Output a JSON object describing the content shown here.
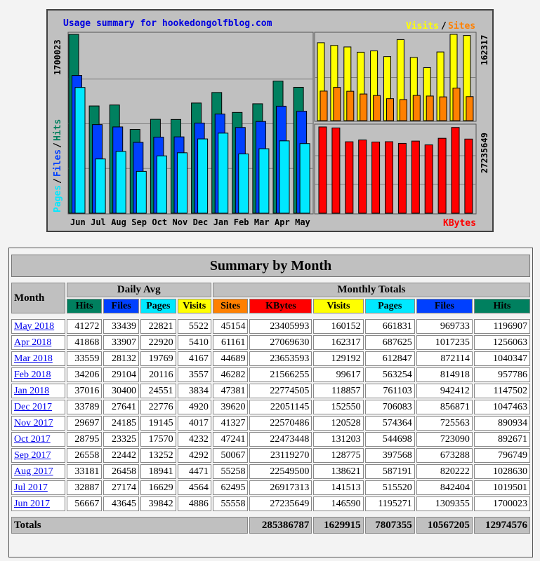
{
  "title": "Usage summary for hookedongolfblog.com",
  "labels": {
    "left_axis": [
      "Pages",
      "Files",
      "Hits"
    ],
    "right_top_legend": [
      "Visits",
      "Sites"
    ],
    "right_bottom_legend": "KBytes",
    "left_max": "1700023",
    "right_top_max": "162317",
    "right_bottom_max": "27235649"
  },
  "colors": {
    "hits": "#00805f",
    "files": "#0040ff",
    "pages": "#00e8ff",
    "visits": "#ffff00",
    "sites": "#ff8000",
    "kbytes": "#ff0000"
  },
  "chart_data": [
    {
      "type": "bar",
      "title": "Usage summary for hookedongolfblog.com",
      "categories": [
        "Jun",
        "Jul",
        "Aug",
        "Sep",
        "Oct",
        "Nov",
        "Dec",
        "Jan",
        "Feb",
        "Mar",
        "Apr",
        "May"
      ],
      "ylim": [
        0,
        1700023
      ],
      "series": [
        {
          "name": "Hits",
          "values": [
            1700023,
            1019501,
            1028630,
            796749,
            892671,
            890934,
            1047463,
            1147502,
            957786,
            1040347,
            1256063,
            1196907
          ]
        },
        {
          "name": "Files",
          "values": [
            1309355,
            842404,
            820222,
            673288,
            723090,
            725563,
            856871,
            942412,
            814918,
            872114,
            1017235,
            969733
          ]
        },
        {
          "name": "Pages",
          "values": [
            1195271,
            515520,
            587191,
            397568,
            544698,
            574364,
            706083,
            761103,
            563254,
            612847,
            687625,
            661831
          ]
        }
      ]
    },
    {
      "type": "bar",
      "categories": [
        "Jun",
        "Jul",
        "Aug",
        "Sep",
        "Oct",
        "Nov",
        "Dec",
        "Jan",
        "Feb",
        "Mar",
        "Apr",
        "May"
      ],
      "ylim": [
        0,
        162317
      ],
      "series": [
        {
          "name": "Visits",
          "values": [
            146590,
            141513,
            138621,
            128775,
            131203,
            120528,
            152550,
            118857,
            99617,
            129192,
            162317,
            160152
          ]
        },
        {
          "name": "Sites",
          "values": [
            55558,
            62495,
            55258,
            50067,
            47241,
            41327,
            39620,
            47381,
            46282,
            44689,
            61161,
            45154
          ]
        }
      ]
    },
    {
      "type": "bar",
      "categories": [
        "Jun",
        "Jul",
        "Aug",
        "Sep",
        "Oct",
        "Nov",
        "Dec",
        "Jan",
        "Feb",
        "Mar",
        "Apr",
        "May"
      ],
      "ylim": [
        0,
        27235649
      ],
      "series": [
        {
          "name": "KBytes",
          "values": [
            27235649,
            26917313,
            22549500,
            23119270,
            22473448,
            22570486,
            22051145,
            22774505,
            21566255,
            23653593,
            27069630,
            23405993
          ]
        }
      ]
    }
  ],
  "table": {
    "title": "Summary by Month",
    "month_header": "Month",
    "daily_avg_header": "Daily Avg",
    "monthly_totals_header": "Monthly Totals",
    "daily_cols": [
      "Hits",
      "Files",
      "Pages",
      "Visits"
    ],
    "monthly_cols": [
      "Sites",
      "KBytes",
      "Visits",
      "Pages",
      "Files",
      "Hits"
    ],
    "rows": [
      {
        "month": "May 2018",
        "d": [
          "41272",
          "33439",
          "22821",
          "5522"
        ],
        "m": [
          "45154",
          "23405993",
          "160152",
          "661831",
          "969733",
          "1196907"
        ]
      },
      {
        "month": "Apr 2018",
        "d": [
          "41868",
          "33907",
          "22920",
          "5410"
        ],
        "m": [
          "61161",
          "27069630",
          "162317",
          "687625",
          "1017235",
          "1256063"
        ]
      },
      {
        "month": "Mar 2018",
        "d": [
          "33559",
          "28132",
          "19769",
          "4167"
        ],
        "m": [
          "44689",
          "23653593",
          "129192",
          "612847",
          "872114",
          "1040347"
        ]
      },
      {
        "month": "Feb 2018",
        "d": [
          "34206",
          "29104",
          "20116",
          "3557"
        ],
        "m": [
          "46282",
          "21566255",
          "99617",
          "563254",
          "814918",
          "957786"
        ]
      },
      {
        "month": "Jan 2018",
        "d": [
          "37016",
          "30400",
          "24551",
          "3834"
        ],
        "m": [
          "47381",
          "22774505",
          "118857",
          "761103",
          "942412",
          "1147502"
        ]
      },
      {
        "month": "Dec 2017",
        "d": [
          "33789",
          "27641",
          "22776",
          "4920"
        ],
        "m": [
          "39620",
          "22051145",
          "152550",
          "706083",
          "856871",
          "1047463"
        ]
      },
      {
        "month": "Nov 2017",
        "d": [
          "29697",
          "24185",
          "19145",
          "4017"
        ],
        "m": [
          "41327",
          "22570486",
          "120528",
          "574364",
          "725563",
          "890934"
        ]
      },
      {
        "month": "Oct 2017",
        "d": [
          "28795",
          "23325",
          "17570",
          "4232"
        ],
        "m": [
          "47241",
          "22473448",
          "131203",
          "544698",
          "723090",
          "892671"
        ]
      },
      {
        "month": "Sep 2017",
        "d": [
          "26558",
          "22442",
          "13252",
          "4292"
        ],
        "m": [
          "50067",
          "23119270",
          "128775",
          "397568",
          "673288",
          "796749"
        ]
      },
      {
        "month": "Aug 2017",
        "d": [
          "33181",
          "26458",
          "18941",
          "4471"
        ],
        "m": [
          "55258",
          "22549500",
          "138621",
          "587191",
          "820222",
          "1028630"
        ]
      },
      {
        "month": "Jul 2017",
        "d": [
          "32887",
          "27174",
          "16629",
          "4564"
        ],
        "m": [
          "62495",
          "26917313",
          "141513",
          "515520",
          "842404",
          "1019501"
        ]
      },
      {
        "month": "Jun 2017",
        "d": [
          "56667",
          "43645",
          "39842",
          "4886"
        ],
        "m": [
          "55558",
          "27235649",
          "146590",
          "1195271",
          "1309355",
          "1700023"
        ]
      }
    ],
    "totals_label": "Totals",
    "totals": [
      "285386787",
      "1629915",
      "7807355",
      "10567205",
      "12974576"
    ]
  }
}
